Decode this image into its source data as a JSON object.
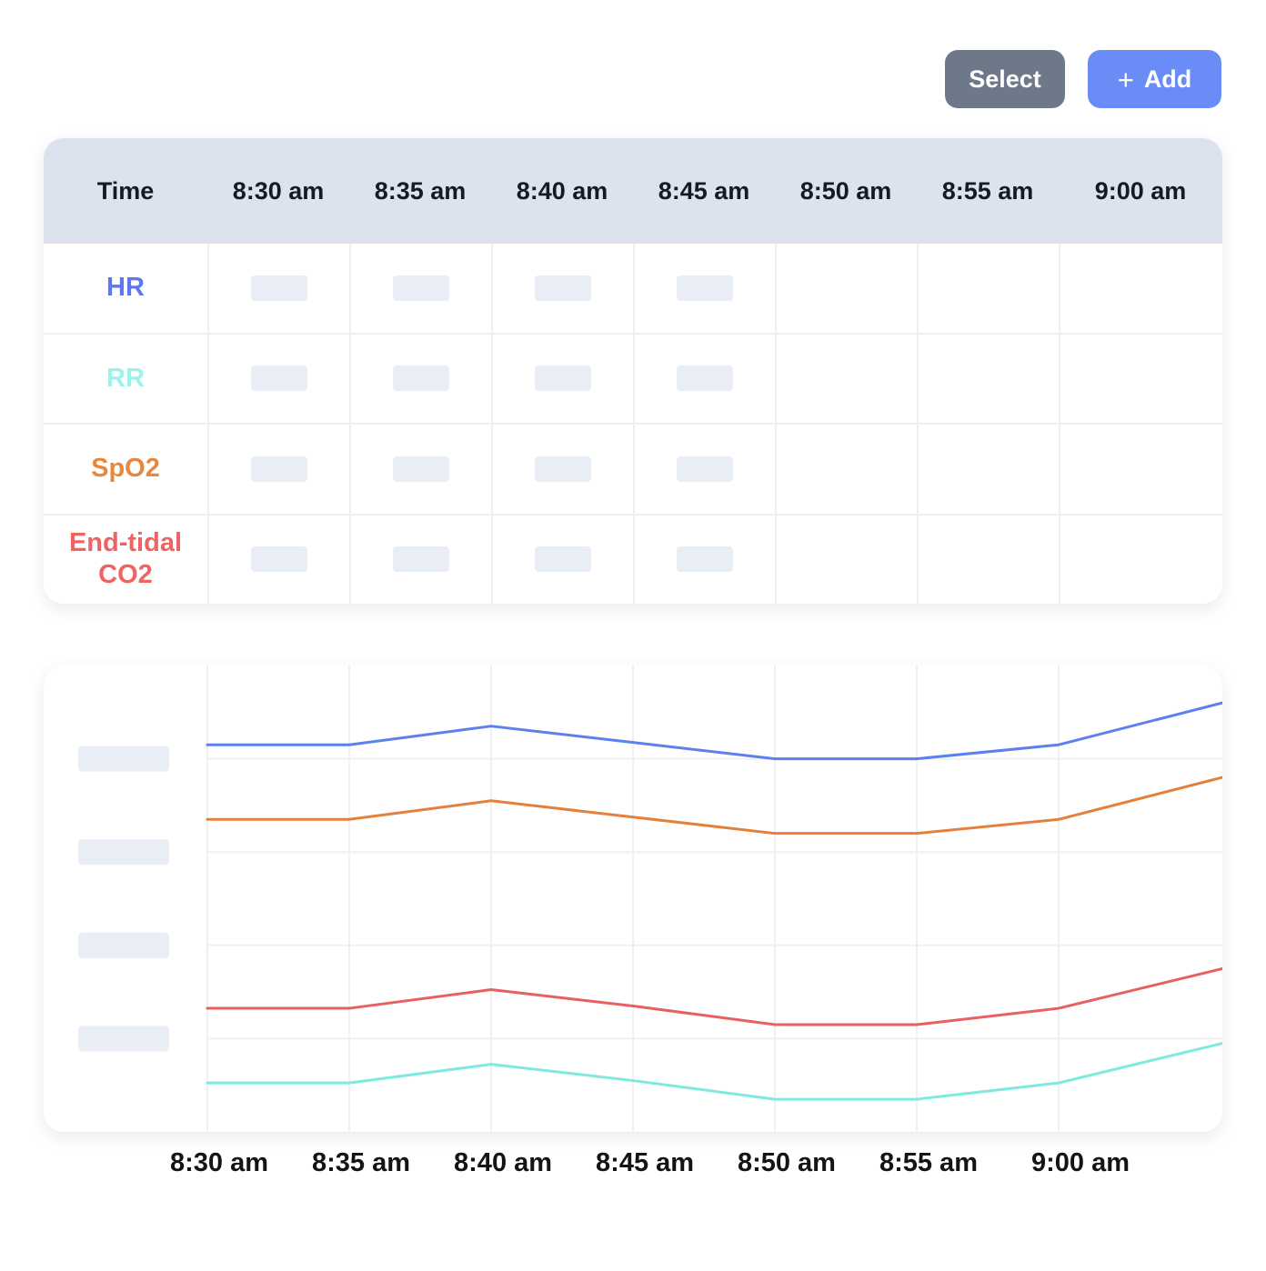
{
  "toolbar": {
    "select_label": "Select",
    "add_label": "Add",
    "add_icon": "+",
    "select_color": "#6d7889",
    "add_color": "#6a8cf6"
  },
  "table": {
    "header": [
      "Time",
      "8:30 am",
      "8:35 am",
      "8:40 am",
      "8:45 am",
      "8:50 am",
      "8:55 am",
      "9:00 am"
    ],
    "header_bg": "#dce3ee",
    "placeholder_columns": [
      0,
      1,
      2,
      3
    ],
    "placeholder_color": "#e9eef6",
    "rows": [
      {
        "label": "HR",
        "color": "#5b78f0"
      },
      {
        "label": "RR",
        "color": "#9cf2ec"
      },
      {
        "label": "SpO2",
        "color": "#e8883e"
      },
      {
        "label": "End-tidal CO2",
        "color": "#ef6363"
      }
    ]
  },
  "chart_data": {
    "type": "line",
    "title": "",
    "xlabel": "",
    "ylabel": "",
    "x_labels": [
      "8:30 am",
      "8:35 am",
      "8:40 am",
      "8:45 am",
      "8:50 am",
      "8:55 am",
      "9:00 am"
    ],
    "x_fracs": [
      0,
      0.1398,
      0.2796,
      0.4194,
      0.5591,
      0.6989,
      0.8387,
      1.0
    ],
    "note": "y-axis tick labels are shown as skeleton placeholder blocks; values below are relative positions on a hidden 0-100 scale",
    "ylim": [
      0,
      100
    ],
    "gridline_values": [
      80,
      60,
      40,
      20
    ],
    "grid_on": true,
    "grid_color": "#f0f0f3",
    "axis_placeholder_color": "#e9eef6",
    "legend": "none",
    "series": [
      {
        "name": "HR",
        "color": "#5c80ee",
        "values": [
          83,
          83,
          87,
          83.5,
          80,
          80,
          83,
          92
        ]
      },
      {
        "name": "SpO2",
        "color": "#e5803c",
        "values": [
          67,
          67,
          71,
          67.5,
          64,
          64,
          67,
          76
        ]
      },
      {
        "name": "End-tidal CO2",
        "color": "#e86060",
        "values": [
          26.5,
          26.5,
          30.5,
          27,
          23,
          23,
          26.5,
          35
        ]
      },
      {
        "name": "RR",
        "color": "#7fe9e1",
        "values": [
          10.5,
          10.5,
          14.5,
          11,
          7,
          7,
          10.5,
          19
        ]
      }
    ]
  }
}
